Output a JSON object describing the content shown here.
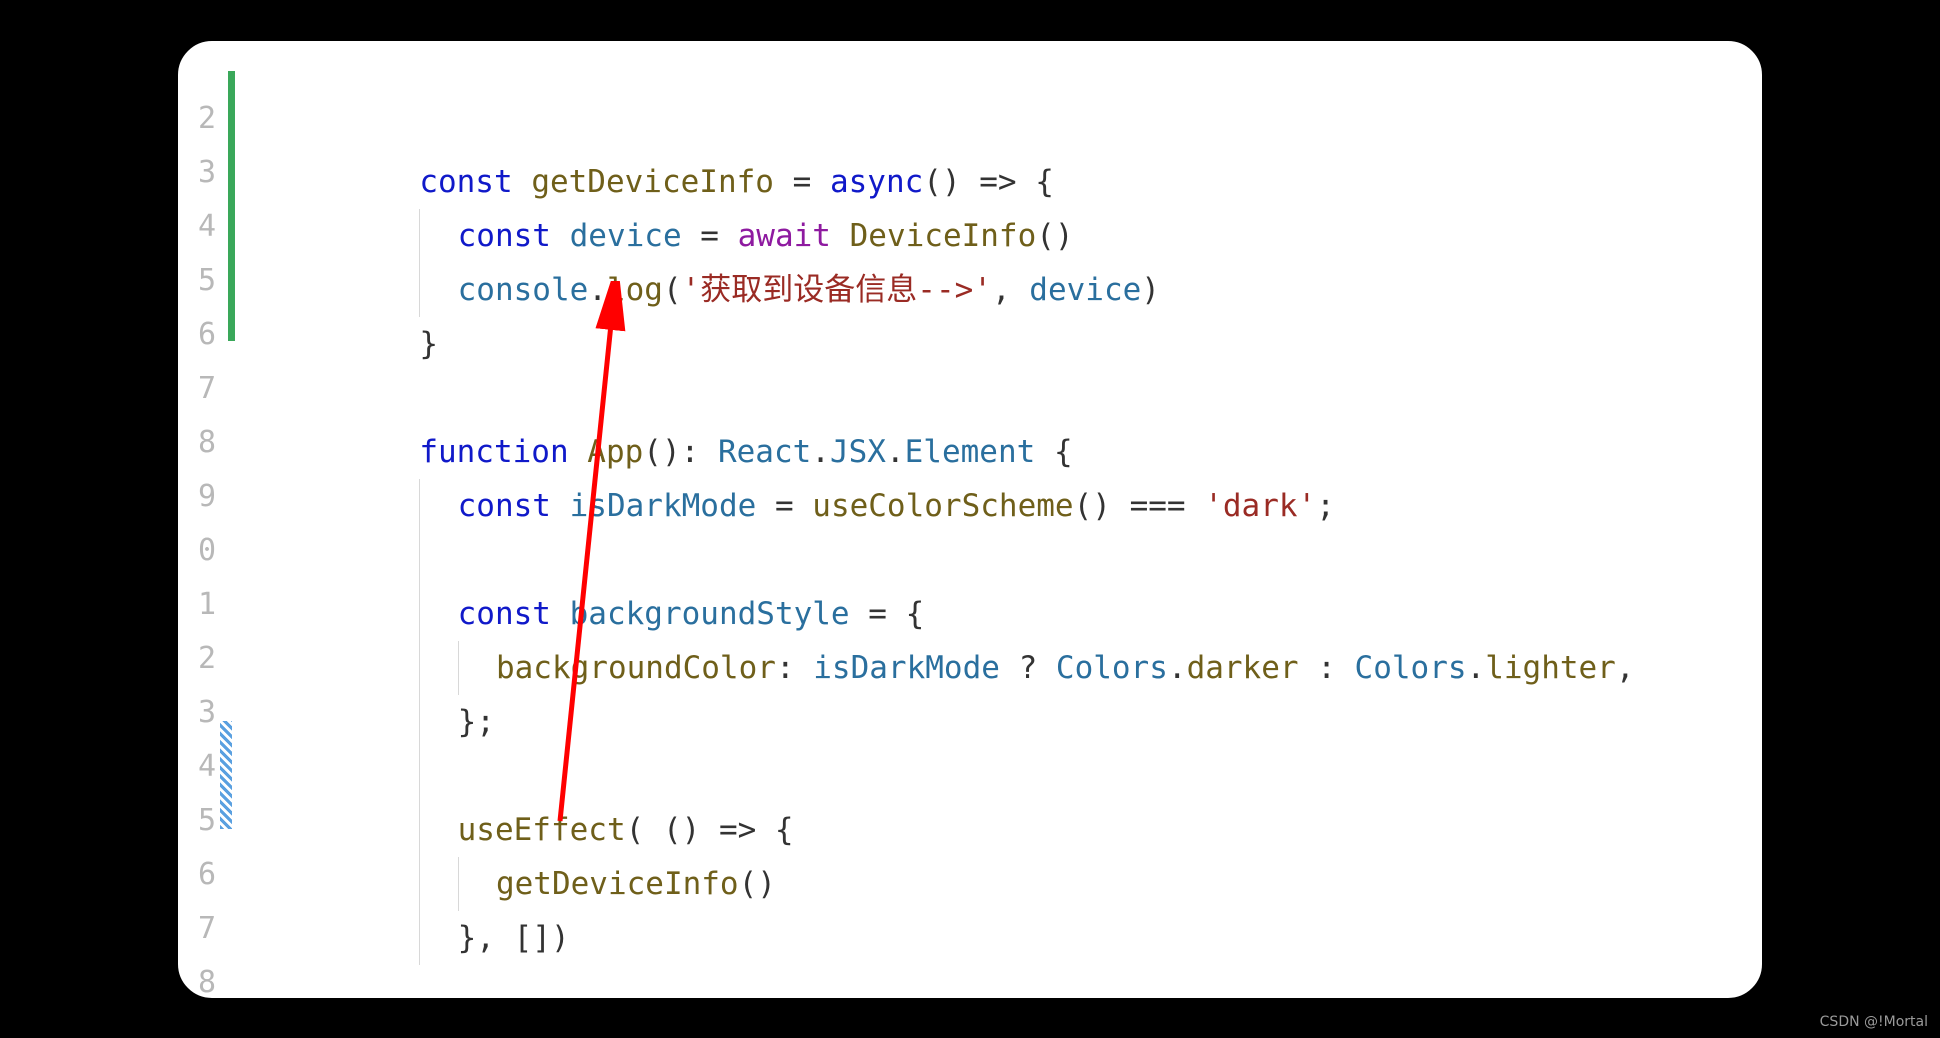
{
  "editor": {
    "lineNumbers": [
      "2",
      "3",
      "4",
      "5",
      "6",
      "7",
      "8",
      "9",
      "0",
      "1",
      "2",
      "3",
      "4",
      "5",
      "6",
      "7",
      "8"
    ],
    "code": {
      "l1": {
        "const": "const",
        "getDeviceInfo": "getDeviceInfo",
        "eq": " = ",
        "async": "async",
        "arr": "() => {"
      },
      "l2": {
        "const": "const",
        "device": "device",
        "eq": " = ",
        "await": "await",
        "DeviceInfo": "DeviceInfo",
        "paren": "()"
      },
      "l3": {
        "console": "console",
        "dot": ".",
        "log": "log",
        "open": "(",
        "str": "'获取到设备信息-->'",
        "comma": ", ",
        "device": "device",
        "close": ")"
      },
      "l4": {
        "brace": "}"
      },
      "l5": "",
      "l6": {
        "function": "function",
        "App": "App",
        "sig": "(): ",
        "React": "React",
        "dot1": ".",
        "JSX": "JSX",
        "dot2": ".",
        "Element": "Element",
        "brace": " {"
      },
      "l7": {
        "const": "const",
        "isDarkMode": "isDarkMode",
        "eq": " = ",
        "useColorScheme": "useColorScheme",
        "call": "() === ",
        "str": "'dark'",
        "semi": ";"
      },
      "l8": "",
      "l9": {
        "const": "const",
        "backgroundStyle": "backgroundStyle",
        "eq": " = {"
      },
      "l10": {
        "backgroundColor": "backgroundColor",
        "colon": ": ",
        "isDarkMode": "isDarkMode",
        "q": " ? ",
        "ColorsD": "Colors",
        "dotD": ".",
        "darker": "darker",
        "colon2": " : ",
        "ColorsL": "Colors",
        "dotL": ".",
        "lighter": "lighter",
        "comma": ","
      },
      "l11": {
        "brace": "};"
      },
      "l12": "",
      "l13": {
        "useEffect": "useEffect",
        "open": "( () => {"
      },
      "l14": {
        "getDeviceInfo": "getDeviceInfo",
        "call": "()"
      },
      "l15": {
        "close": "}, [])"
      }
    }
  },
  "annotation": {
    "type": "arrow",
    "color": "#ff0000"
  },
  "watermark": "CSDN @!Mortal"
}
